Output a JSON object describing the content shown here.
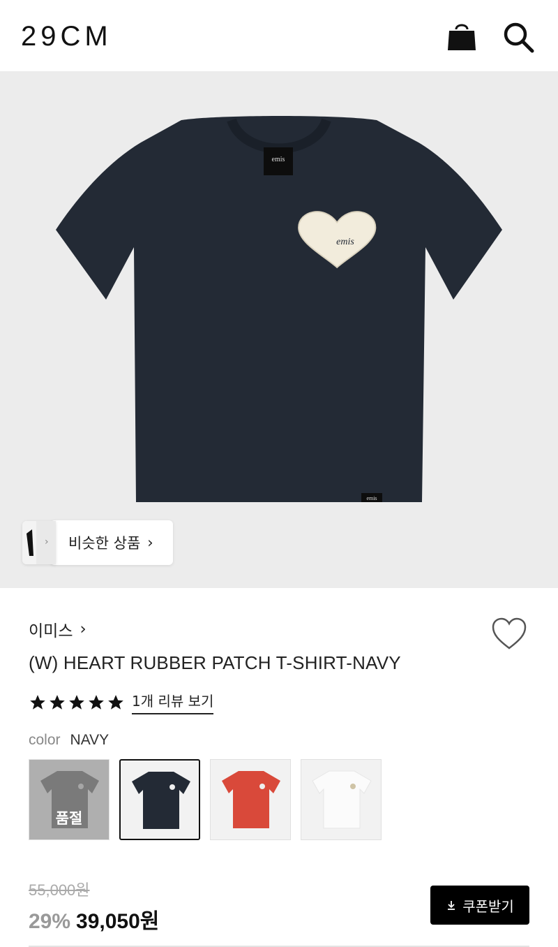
{
  "header": {
    "logo": "29CM",
    "bag_icon": "shopping-bag-icon",
    "search_icon": "search-icon"
  },
  "hero": {
    "product_image": "navy-tshirt-image",
    "similar_label": "비슷한 상품",
    "similar_chevron": "›"
  },
  "product": {
    "brand": "이미스",
    "brand_chevron": "›",
    "title": "(W) HEART RUBBER PATCH T-SHIRT-NAVY",
    "rating_stars": 5,
    "review_link": "1개 리뷰 보기",
    "wishlist_icon": "heart-outline-icon"
  },
  "options": {
    "color_label": "color",
    "color_value": "NAVY",
    "swatches": [
      {
        "color": "#7d7d7d",
        "sold_out": true,
        "label": "품절"
      },
      {
        "color": "#232a35",
        "sold_out": false,
        "selected": true
      },
      {
        "color": "#d9493a",
        "sold_out": false
      },
      {
        "color": "#f7f7f7",
        "sold_out": false
      }
    ]
  },
  "pricing": {
    "original": "55,000원",
    "discount": "29%",
    "sale": "39,050원",
    "coupon_button": "쿠폰받기"
  },
  "colors": {
    "accent": "#000000",
    "hero_bg": "#ececec",
    "shirt": "#232a35"
  }
}
